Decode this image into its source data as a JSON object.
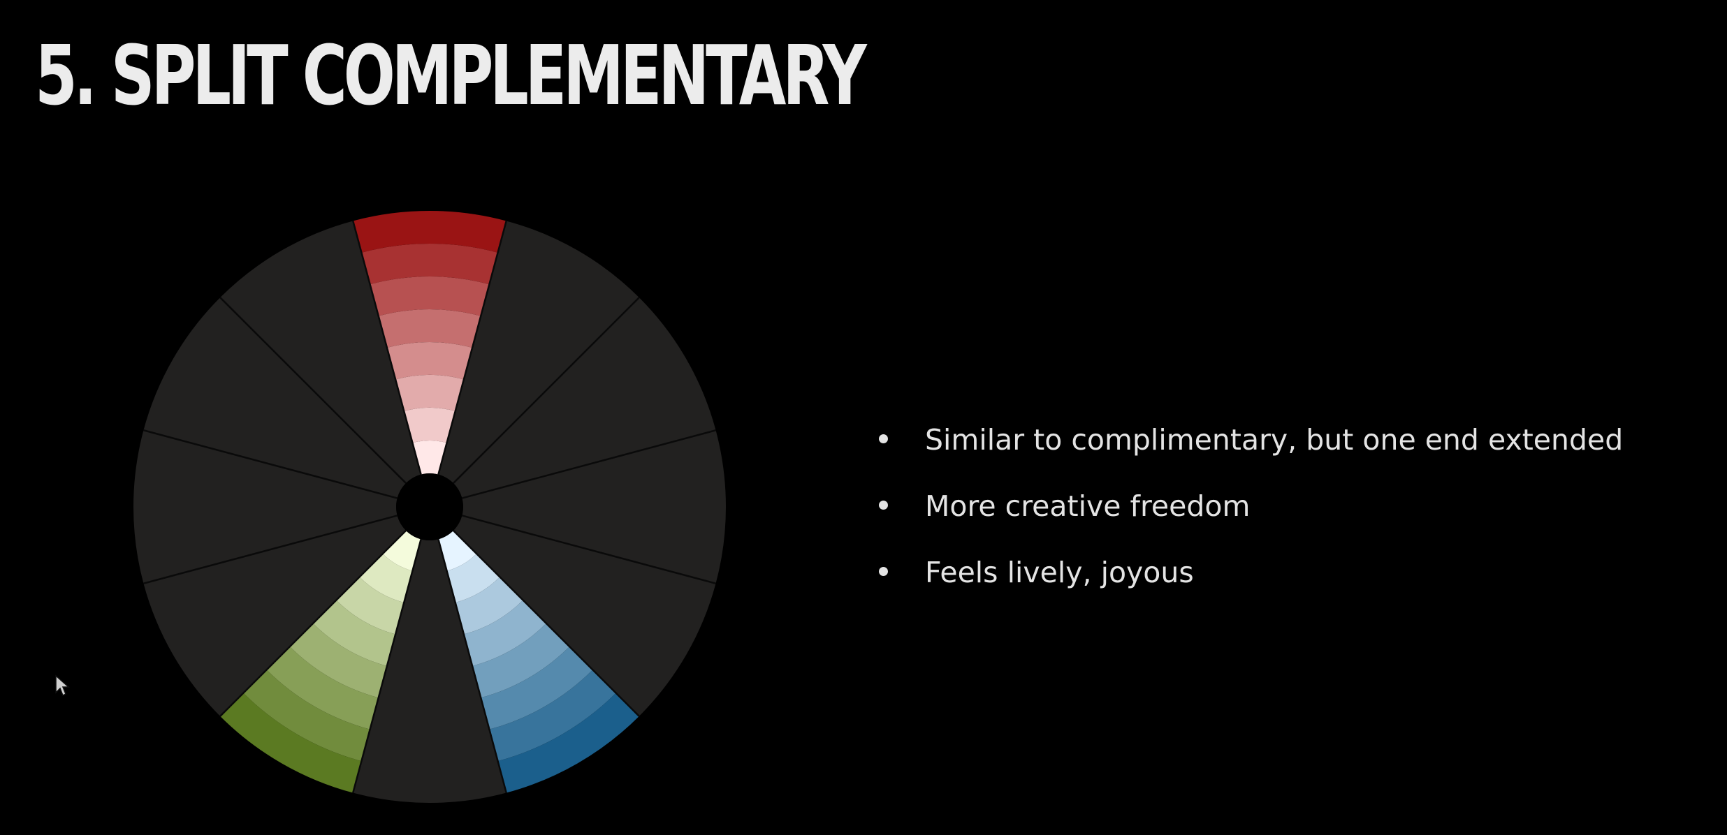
{
  "slide": {
    "title": "5. SPLIT COMPLEMENTARY",
    "bullets": [
      "Similar to complimentary, but one end extended",
      "More creative freedom",
      "Feels lively, joyous"
    ]
  },
  "color_wheel": {
    "segments": 12,
    "highlighted": [
      {
        "name": "red",
        "segment": 0,
        "inner": "#ffe8e8",
        "outer": "#9a1414"
      },
      {
        "name": "blue",
        "segment": 5,
        "inner": "#e6f4ff",
        "outer": "#1b5f8c"
      },
      {
        "name": "yellow-green",
        "segment": 7,
        "inner": "#f4fbdc",
        "outer": "#5b7a22"
      }
    ],
    "muted_fill": "#222120",
    "center_hole": "#000000"
  },
  "colors": {
    "background": "#000000",
    "title": "#ececec",
    "text": "#e4e4e4"
  },
  "icons": {
    "cursor": "mouse-pointer-icon"
  }
}
